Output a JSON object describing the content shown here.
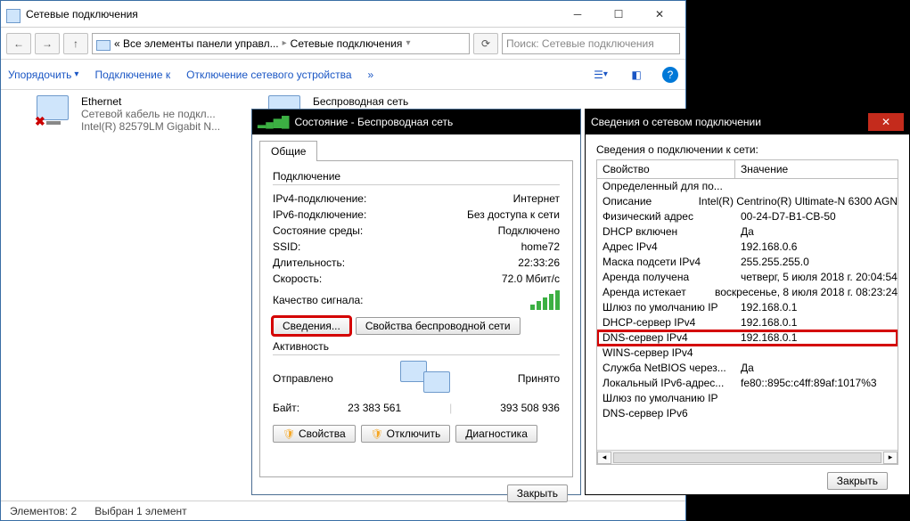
{
  "explorer": {
    "title": "Сетевые подключения",
    "breadcrumb": {
      "prefix": "« Все элементы панели управл...",
      "current": "Сетевые подключения"
    },
    "search_placeholder": "Поиск: Сетевые подключения",
    "toolbar": {
      "organize": "Упорядочить",
      "connect": "Подключение к",
      "disable": "Отключение сетевого устройства",
      "more": "»"
    },
    "adapters": {
      "ethernet": {
        "name": "Ethernet",
        "status": "Сетевой кабель не подкл...",
        "device": "Intel(R) 82579LM Gigabit N..."
      },
      "wireless": {
        "name": "Беспроводная сеть"
      }
    },
    "status_left": "Элементов: 2",
    "status_right": "Выбран 1 элемент"
  },
  "statusdlg": {
    "title": "Состояние - Беспроводная сеть",
    "tab": "Общие",
    "group_conn": "Подключение",
    "rows": {
      "ipv4_lbl": "IPv4-подключение:",
      "ipv4_val": "Интернет",
      "ipv6_lbl": "IPv6-подключение:",
      "ipv6_val": "Без доступа к сети",
      "media_lbl": "Состояние среды:",
      "media_val": "Подключено",
      "ssid_lbl": "SSID:",
      "ssid_val": "home72",
      "dur_lbl": "Длительность:",
      "dur_val": "22:33:26",
      "speed_lbl": "Скорость:",
      "speed_val": "72.0 Мбит/с",
      "signal_lbl": "Качество сигнала:"
    },
    "btn_details": "Сведения...",
    "btn_wprops": "Свойства беспроводной сети",
    "group_act": "Активность",
    "sent_lbl": "Отправлено",
    "recv_lbl": "Принято",
    "bytes_lbl": "Байт:",
    "sent_bytes": "23 383 561",
    "recv_bytes": "393 508 936",
    "btn_props": "Свойства",
    "btn_disable": "Отключить",
    "btn_diag": "Диагностика",
    "btn_close": "Закрыть"
  },
  "detailsdlg": {
    "title": "Сведения о сетевом подключении",
    "list_label": "Сведения о подключении к сети:",
    "col1": "Свойство",
    "col2": "Значение",
    "rows": [
      {
        "k": "Определенный для по...",
        "v": ""
      },
      {
        "k": "Описание",
        "v": "Intel(R) Centrino(R) Ultimate-N 6300 AGN"
      },
      {
        "k": "Физический адрес",
        "v": "00-24-D7-B1-CB-50"
      },
      {
        "k": "DHCP включен",
        "v": "Да"
      },
      {
        "k": "Адрес IPv4",
        "v": "192.168.0.6"
      },
      {
        "k": "Маска подсети IPv4",
        "v": "255.255.255.0"
      },
      {
        "k": "Аренда получена",
        "v": "четверг, 5 июля 2018 г. 20:04:54"
      },
      {
        "k": "Аренда истекает",
        "v": "воскресенье, 8 июля 2018 г. 08:23:24"
      },
      {
        "k": "Шлюз по умолчанию IP",
        "v": "192.168.0.1"
      },
      {
        "k": "DHCP-сервер IPv4",
        "v": "192.168.0.1"
      },
      {
        "k": "DNS-сервер IPv4",
        "v": "192.168.0.1"
      },
      {
        "k": "WINS-сервер IPv4",
        "v": ""
      },
      {
        "k": "Служба NetBIOS через...",
        "v": "Да"
      },
      {
        "k": "Локальный IPv6-адрес...",
        "v": "fe80::895c:c4ff:89af:1017%3"
      },
      {
        "k": "Шлюз по умолчанию IP",
        "v": ""
      },
      {
        "k": "DNS-сервер IPv6",
        "v": ""
      }
    ],
    "highlight_index": 10,
    "btn_close": "Закрыть"
  }
}
